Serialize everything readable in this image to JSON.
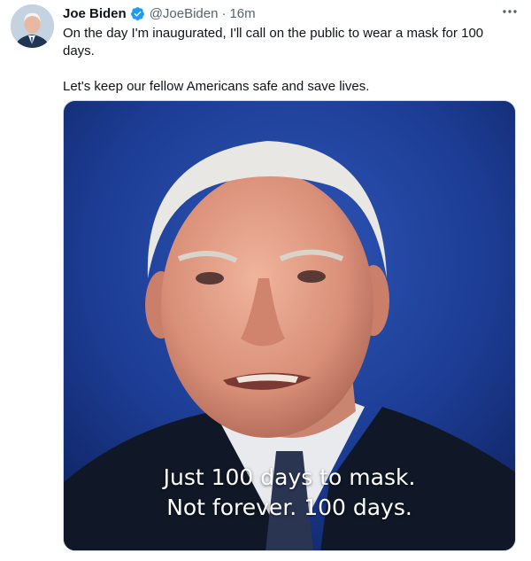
{
  "tweet": {
    "display_name": "Joe Biden",
    "handle": "@JoeBiden",
    "separator": "·",
    "time": "16m",
    "text_line_1": "On the day I'm inaugurated, I'll call on the public to wear a mask for 100 days.",
    "text_line_2": "Let's keep our fellow Americans safe and save lives.",
    "media": {
      "caption_line_1": "Just 100 days to mask.",
      "caption_line_2": "Not forever. 100 days."
    }
  },
  "icons": {
    "verified": "verified-badge-icon",
    "more": "more-options-icon"
  },
  "colors": {
    "verified_blue": "#1d9bf0",
    "secondary_text": "#536471",
    "media_background": "#1b3a8c"
  }
}
